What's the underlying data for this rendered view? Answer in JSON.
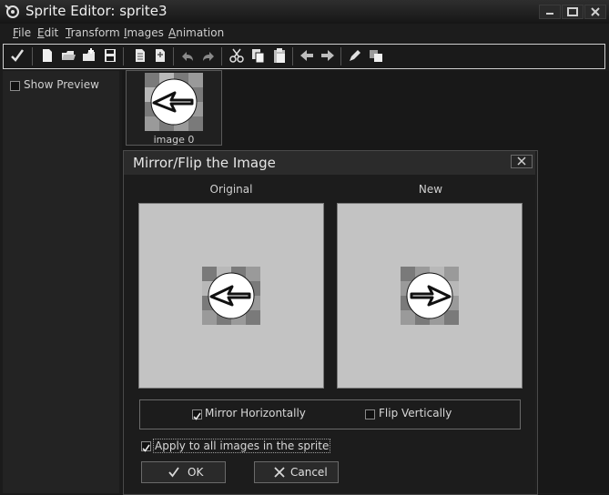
{
  "window": {
    "title": "Sprite Editor: sprite3"
  },
  "menu": [
    {
      "underline": "F",
      "rest": "ile"
    },
    {
      "underline": "E",
      "rest": "dit"
    },
    {
      "underline": "T",
      "rest": "ransform"
    },
    {
      "underline": "I",
      "rest": "mages"
    },
    {
      "underline": "A",
      "rest": "nimation"
    }
  ],
  "left_panel": {
    "show_preview_label": "Show Preview",
    "show_preview_checked": false
  },
  "images": [
    {
      "caption": "image 0"
    }
  ],
  "dialog": {
    "title": "Mirror/Flip the Image",
    "original_label": "Original",
    "new_label": "New",
    "mirror_horizontally_label": "Mirror Horizontally",
    "mirror_horizontally_checked": true,
    "flip_vertically_label": "Flip Vertically",
    "flip_vertically_checked": false,
    "apply_all_label": "Apply to all images in the sprite",
    "apply_all_checked": true,
    "ok_label": "OK",
    "cancel_label": "Cancel"
  }
}
